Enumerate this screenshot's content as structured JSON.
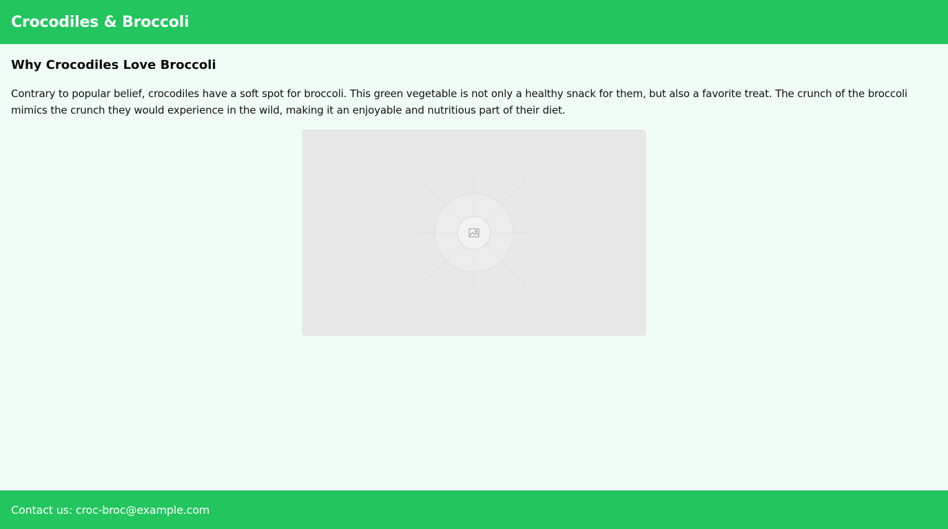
{
  "header": {
    "title": "Crocodiles & Broccoli",
    "background_color": "#22c55e"
  },
  "article": {
    "heading": "Why Crocodiles Love Broccoli",
    "body": "Contrary to popular belief, crocodiles have a soft spot for broccoli. This green vegetable is not only a healthy snack for them, but also a favorite treat. The crunch of the broccoli mimics the crunch they would experience in the wild, making it an enjoyable and nutritious part of their diet.",
    "image": {
      "icon": "image-placeholder-icon"
    }
  },
  "footer": {
    "contact_text": "Contact us: croc-broc@example.com",
    "background_color": "#22c55e"
  },
  "colors": {
    "page_background": "#f0fdf4",
    "accent": "#22c55e",
    "placeholder_background": "#e8e8e8"
  }
}
